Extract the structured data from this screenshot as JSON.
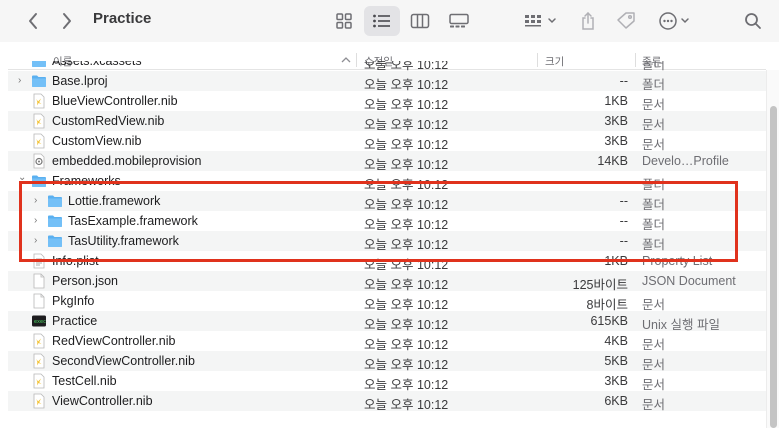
{
  "toolbar": {
    "title": "Practice"
  },
  "header": {
    "name": "이름",
    "date": "수정일",
    "size": "크기",
    "kind": "종류"
  },
  "rows": [
    {
      "name": "Assets.xcassets",
      "date": "오늘 오후 10:12",
      "size": "",
      "kind": "폴더",
      "icon": "folder-icon",
      "disclosure": "",
      "indent": 0,
      "partial": true
    },
    {
      "name": "Base.lproj",
      "date": "오늘 오후 10:12",
      "size": "--",
      "kind": "폴더",
      "icon": "folder-icon",
      "disclosure": "closed",
      "indent": 0
    },
    {
      "name": "BlueViewController.nib",
      "date": "오늘 오후 10:12",
      "size": "1KB",
      "kind": "문서",
      "icon": "nib-file-icon",
      "disclosure": "",
      "indent": 0
    },
    {
      "name": "CustomRedView.nib",
      "date": "오늘 오후 10:12",
      "size": "3KB",
      "kind": "문서",
      "icon": "nib-file-icon",
      "disclosure": "",
      "indent": 0
    },
    {
      "name": "CustomView.nib",
      "date": "오늘 오후 10:12",
      "size": "3KB",
      "kind": "문서",
      "icon": "nib-file-icon",
      "disclosure": "",
      "indent": 0
    },
    {
      "name": "embedded.mobileprovision",
      "date": "오늘 오후 10:12",
      "size": "14KB",
      "kind": "Develo…Profile",
      "icon": "provision-file-icon",
      "disclosure": "",
      "indent": 0
    },
    {
      "name": "Frameworks",
      "date": "오늘 오후 10:12",
      "size": "--",
      "kind": "폴더",
      "icon": "folder-icon",
      "disclosure": "open",
      "indent": 0
    },
    {
      "name": "Lottie.framework",
      "date": "오늘 오후 10:12",
      "size": "--",
      "kind": "폴더",
      "icon": "folder-icon",
      "disclosure": "closed",
      "indent": 1
    },
    {
      "name": "TasExample.framework",
      "date": "오늘 오후 10:12",
      "size": "--",
      "kind": "폴더",
      "icon": "folder-icon",
      "disclosure": "closed",
      "indent": 1
    },
    {
      "name": "TasUtility.framework",
      "date": "오늘 오후 10:12",
      "size": "--",
      "kind": "폴더",
      "icon": "folder-icon",
      "disclosure": "closed",
      "indent": 1
    },
    {
      "name": "Info.plist",
      "date": "오늘 오후 10:12",
      "size": "1KB",
      "kind": "Property List",
      "icon": "plist-file-icon",
      "disclosure": "",
      "indent": 0
    },
    {
      "name": "Person.json",
      "date": "오늘 오후 10:12",
      "size": "125바이트",
      "kind": "JSON Document",
      "icon": "document-icon",
      "disclosure": "",
      "indent": 0
    },
    {
      "name": "PkgInfo",
      "date": "오늘 오후 10:12",
      "size": "8바이트",
      "kind": "문서",
      "icon": "document-icon",
      "disclosure": "",
      "indent": 0
    },
    {
      "name": "Practice",
      "date": "오늘 오후 10:12",
      "size": "615KB",
      "kind": "Unix 실행 파일",
      "icon": "executable-icon",
      "disclosure": "",
      "indent": 0
    },
    {
      "name": "RedViewController.nib",
      "date": "오늘 오후 10:12",
      "size": "4KB",
      "kind": "문서",
      "icon": "nib-file-icon",
      "disclosure": "",
      "indent": 0
    },
    {
      "name": "SecondViewController.nib",
      "date": "오늘 오후 10:12",
      "size": "5KB",
      "kind": "문서",
      "icon": "nib-file-icon",
      "disclosure": "",
      "indent": 0
    },
    {
      "name": "TestCell.nib",
      "date": "오늘 오후 10:12",
      "size": "3KB",
      "kind": "문서",
      "icon": "nib-file-icon",
      "disclosure": "",
      "indent": 0
    },
    {
      "name": "ViewController.nib",
      "date": "오늘 오후 10:12",
      "size": "6KB",
      "kind": "문서",
      "icon": "nib-file-icon",
      "disclosure": "",
      "indent": 0
    }
  ],
  "colors": {
    "folder": "#5ab0f0",
    "highlight": "#e0321d",
    "selected_view_bg": "#e3e3e6"
  }
}
